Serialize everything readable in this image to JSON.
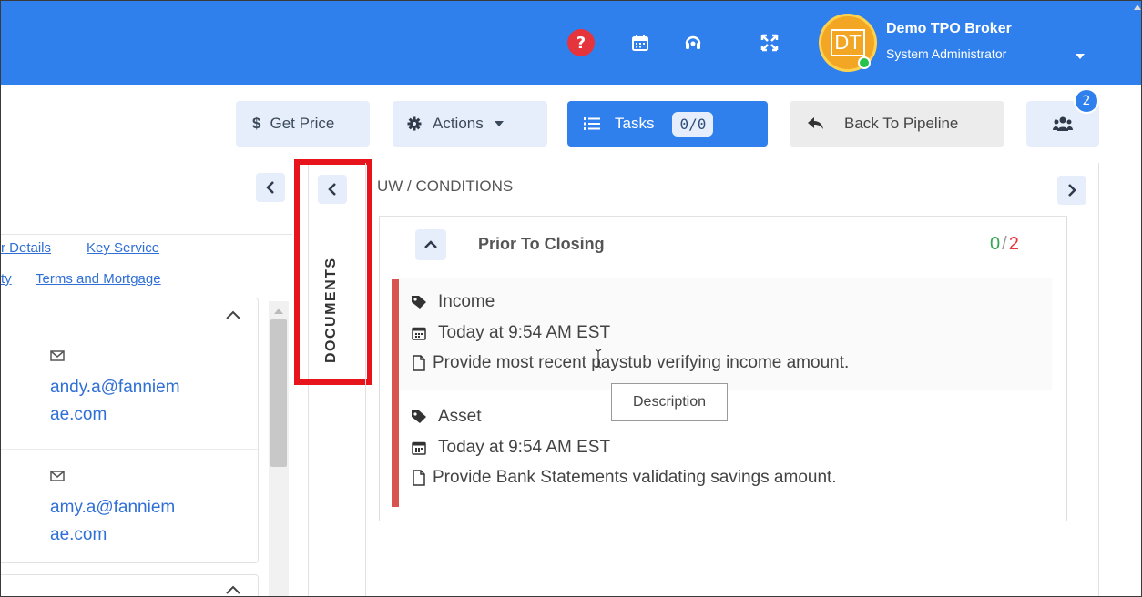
{
  "header": {
    "user_initials": "DT",
    "user_name": "Demo TPO Broker",
    "user_role": "System Administrator",
    "help_glyph": "?",
    "icons": [
      "help-icon",
      "calendar-icon",
      "headset-icon",
      "fullscreen-icon"
    ]
  },
  "toolbar": {
    "get_price_symbol": "$",
    "get_price_label": "Get Price",
    "actions_label": "Actions",
    "tasks_label": "Tasks",
    "tasks_count": "0/0",
    "back_label": "Back To Pipeline",
    "users_badge": "2"
  },
  "left": {
    "links": [
      "r Details",
      "Key Service",
      "ty",
      "Terms and Mortgage"
    ],
    "contacts": [
      {
        "email_line1": "andy.a@fanniem",
        "email_line2": "ae.com"
      },
      {
        "email_line1": "amy.a@fanniem",
        "email_line2": "ae.com"
      }
    ]
  },
  "documents": {
    "label": "DOCUMENTS"
  },
  "conditions": {
    "title": "UW / CONDITIONS",
    "section_title": "Prior To Closing",
    "progress_done": "0",
    "progress_sep": "/",
    "progress_total": "2",
    "items": [
      {
        "category": "Income",
        "time": "Today at 9:54 AM EST",
        "description": "Provide most recent paystub verifying income amount."
      },
      {
        "category": "Asset",
        "time": "Today at 9:54 AM EST",
        "description": "Provide Bank Statements validating savings amount."
      }
    ],
    "tooltip": "Description"
  },
  "colors": {
    "header_blue": "#2f80ed",
    "highlight_red": "#e8141b",
    "done_green": "#2fa84f",
    "total_red": "#e5343b"
  }
}
